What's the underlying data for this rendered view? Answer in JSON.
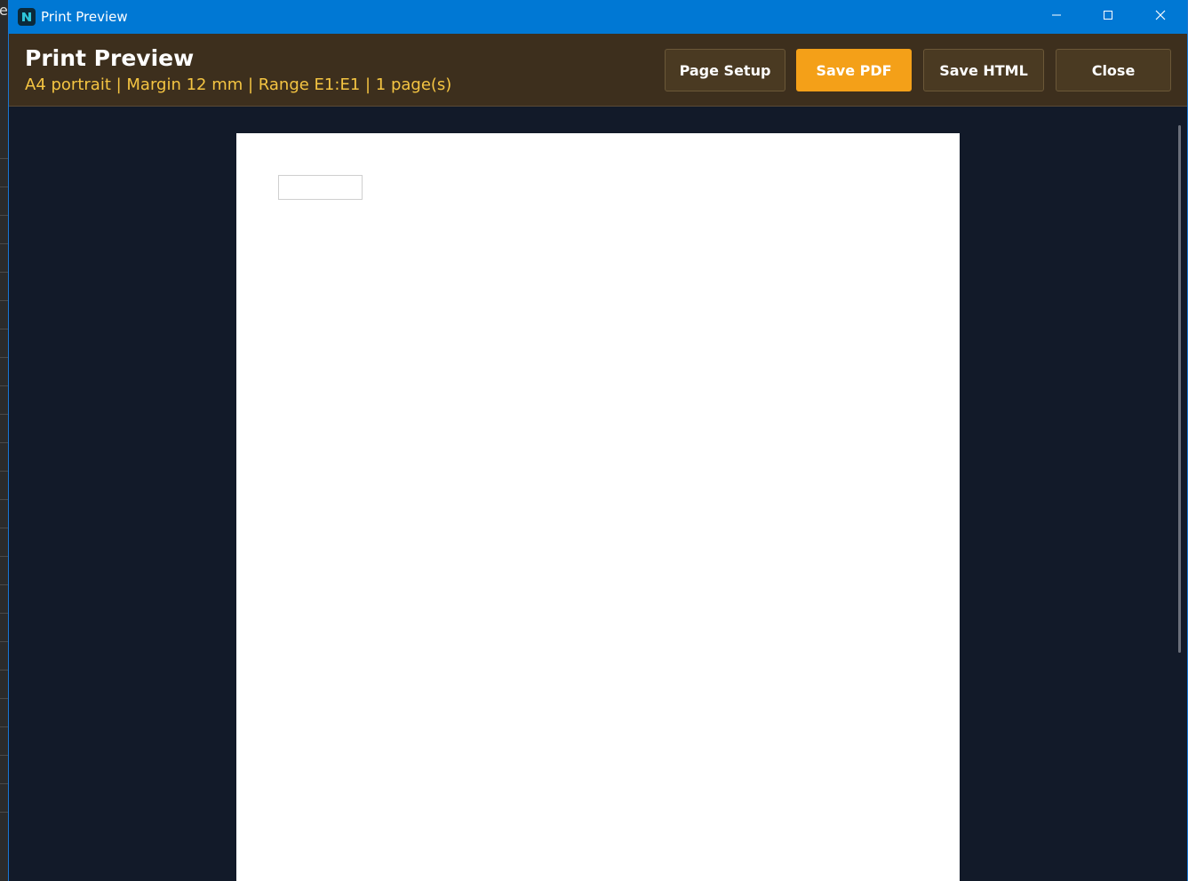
{
  "window": {
    "title": "Print Preview",
    "accent_color": "#0078d4"
  },
  "header": {
    "title": "Print Preview",
    "subtitle": "A4 portrait | Margin 12 mm | Range E1:E1 | 1 page(s)",
    "subtitle_color": "#f5c542"
  },
  "buttons": {
    "page_setup": "Page Setup",
    "save_pdf": "Save PDF",
    "save_html": "Save HTML",
    "close": "Close",
    "primary_color": "#f4a018"
  },
  "icons": {
    "app": "app-logo-icon",
    "minimize": "minimize-icon",
    "maximize": "maximize-icon",
    "close": "close-icon"
  },
  "background_app": {
    "partial_text": "e"
  }
}
